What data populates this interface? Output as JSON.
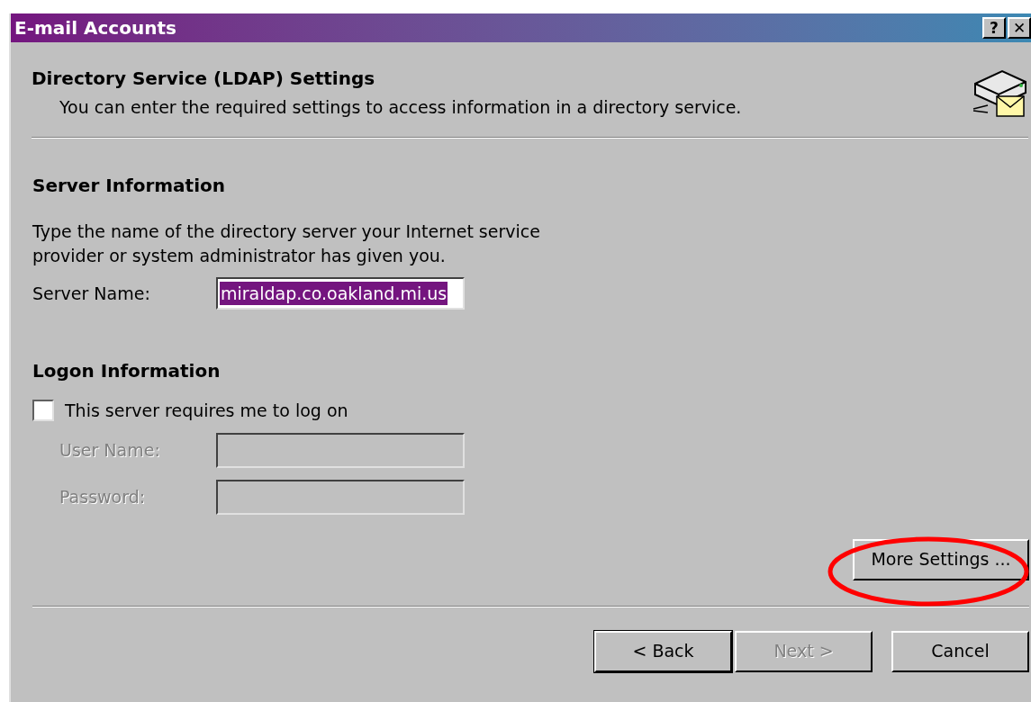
{
  "window": {
    "title": "E-mail Accounts",
    "buttons": [
      "?",
      "✕"
    ]
  },
  "header": {
    "title": "Directory Service (LDAP) Settings",
    "subtitle": "You can enter the required settings to access information in a directory service."
  },
  "server_information": {
    "heading": "Server Information",
    "description": "Type the name of the directory server your Internet service provider or system administrator has given you.",
    "server_name": {
      "label": "Server Name:",
      "value": "miraldap.co.oakland.mi.us",
      "selected": true
    }
  },
  "logon_information": {
    "heading": "Logon Information",
    "checkbox": {
      "label": "This server requires me to log on",
      "checked": false
    },
    "fields": [
      {
        "label": "User Name:",
        "disabled": true
      },
      {
        "label": "Password:",
        "disabled": true
      }
    ]
  },
  "more_settings": {
    "label": "More Settings ..."
  },
  "buttons": [
    {
      "label": "< Back",
      "disabled": false
    },
    {
      "label": "Next >",
      "disabled": true
    },
    {
      "label": "Cancel",
      "disabled": false
    }
  ]
}
